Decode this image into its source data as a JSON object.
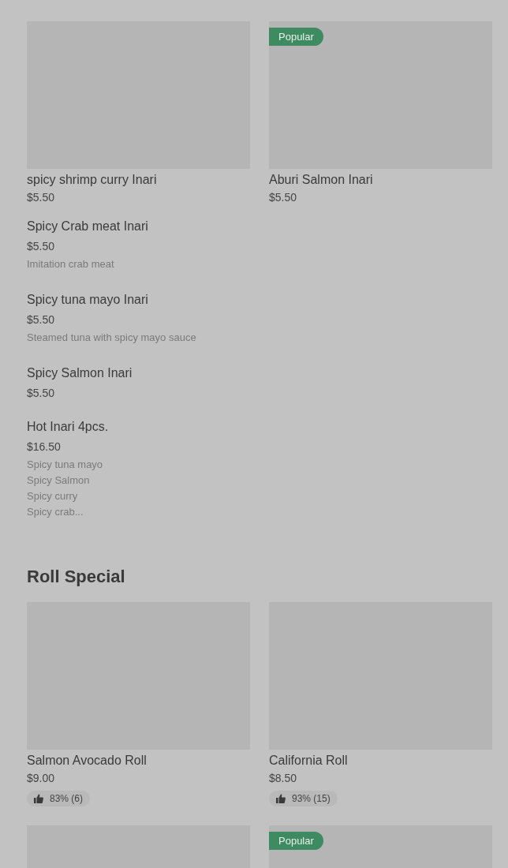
{
  "sections": [
    {
      "grid": [
        {
          "kind": "item",
          "name": "spicy shrimp curry Inari",
          "price": "$5.50"
        },
        {
          "kind": "item",
          "name": "Aburi Salmon Inari",
          "price": "$5.50",
          "badge": "Popular"
        }
      ],
      "list": [
        {
          "name": "Spicy Crab meat Inari",
          "price": "$5.50",
          "description": "Imitation crab meat"
        },
        {
          "name": "Spicy tuna mayo Inari",
          "price": "$5.50",
          "description": "Steamed tuna with spicy mayo sauce"
        },
        {
          "name": "Spicy Salmon Inari",
          "price": "$5.50"
        },
        {
          "name": "Hot Inari 4pcs.",
          "price": "$16.50",
          "description": "Spicy tuna mayo\nSpicy Salmon\nSpicy curry\nSpicy crab..."
        }
      ]
    },
    {
      "title": "Roll Special",
      "grid": [
        {
          "kind": "item",
          "name": "Salmon Avocado Roll",
          "price": "$9.00",
          "rating": "83% (6)"
        },
        {
          "kind": "item",
          "name": "California Roll",
          "price": "$8.50",
          "rating": "93% (15)"
        },
        {
          "kind": "picture"
        },
        {
          "kind": "picture",
          "badge": "Popular"
        }
      ]
    }
  ]
}
